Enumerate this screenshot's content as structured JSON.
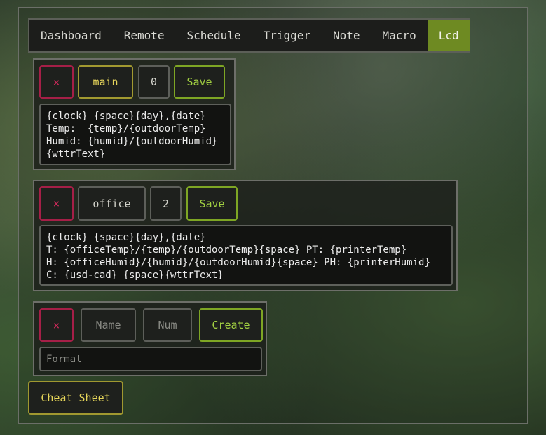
{
  "nav": {
    "tabs": [
      {
        "label": "Dashboard"
      },
      {
        "label": "Remote"
      },
      {
        "label": "Schedule"
      },
      {
        "label": "Trigger"
      },
      {
        "label": "Note"
      },
      {
        "label": "Macro"
      },
      {
        "label": "Lcd"
      }
    ],
    "active": "Lcd"
  },
  "screens": [
    {
      "delete_label": "×",
      "name": "main",
      "num": "0",
      "save_label": "Save",
      "format": "{clock} {space}{day},{date}\nTemp:  {temp}/{outdoorTemp}\nHumid: {humid}/{outdoorHumid}\n{wttrText}"
    },
    {
      "delete_label": "×",
      "name": "office",
      "num": "2",
      "save_label": "Save",
      "format": "{clock} {space}{day},{date}\nT: {officeTemp}/{temp}/{outdoorTemp}{space} PT: {printerTemp}\nH: {officeHumid}/{humid}/{outdoorHumid}{space} PH: {printerHumid}\nC: {usd-cad} {space}{wttrText}"
    }
  ],
  "new_screen": {
    "delete_label": "×",
    "name_placeholder": "Name",
    "num_placeholder": "Num",
    "create_label": "Create",
    "format_placeholder": "Format"
  },
  "cheat_sheet_label": "Cheat Sheet",
  "colors": {
    "accent_active": "#6e8a22",
    "delete": "#d02a5b",
    "name": "#e4d35a",
    "save": "#a3d142"
  }
}
